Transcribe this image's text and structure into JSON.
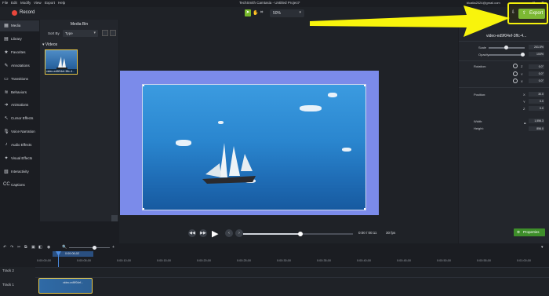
{
  "menu": {
    "items": [
      "File",
      "Edit",
      "Modify",
      "View",
      "Export",
      "Help"
    ],
    "app_title": "TechSmith Camtasia - Untitled Project*",
    "account_email": "blcatla2024@gmail.com",
    "window_controls": [
      "—",
      "□",
      "✕"
    ]
  },
  "toolbar": {
    "record_label": "Record",
    "zoom_value": "50%",
    "export_label": "Export"
  },
  "nav": {
    "items": [
      {
        "label": "Media",
        "icon": "media-icon",
        "active": true
      },
      {
        "label": "Library",
        "icon": "library-icon"
      },
      {
        "label": "Favorites",
        "icon": "star-icon"
      },
      {
        "label": "Annotations",
        "icon": "annotation-icon"
      },
      {
        "label": "Transitions",
        "icon": "transition-icon"
      },
      {
        "label": "Behaviors",
        "icon": "behavior-icon"
      },
      {
        "label": "Animations",
        "icon": "animation-icon"
      },
      {
        "label": "Cursor Effects",
        "icon": "cursor-icon"
      },
      {
        "label": "Voice Narration",
        "icon": "microphone-icon"
      },
      {
        "label": "Audio Effects",
        "icon": "audio-icon"
      },
      {
        "label": "Visual Effects",
        "icon": "visual-effects-icon"
      },
      {
        "label": "Interactivity",
        "icon": "interactivity-icon"
      },
      {
        "label": "Captions",
        "icon": "captions-icon"
      }
    ]
  },
  "media_bin": {
    "title": "Media Bin",
    "sort_label": "Sort By",
    "sort_value": "Type",
    "group": "Videos",
    "clip_name": "video-ed9f04ef-3ffc-4..."
  },
  "playback": {
    "timecode": "0:00 / 00:11",
    "fps": "30 fps",
    "progress": 0.52
  },
  "properties": {
    "clip_title": "video-ed9f04ef-3ffc-4...",
    "scale_label": "Scale",
    "scale_value": "241.5%",
    "opacity_label": "Opacity",
    "opacity_value": "100%",
    "rotation_label": "Rotation:",
    "rotation": {
      "z": "0.0°",
      "y": "0.0°",
      "x": "0.0°"
    },
    "position_label": "Position:",
    "position": {
      "x": "30.0",
      "y": "0.0",
      "z": "0.0"
    },
    "width_label": "Width:",
    "width_value": "1,556.3",
    "height_label": "Height:",
    "height_value": "856.0",
    "button_label": "Properties"
  },
  "timeline": {
    "playhead_time": "0:00:06;02",
    "ticks": [
      "0:00:00;00",
      "0:00:05;00",
      "0:00:10;00",
      "0:00:15;00",
      "0:00:20;00",
      "0:00:25;00",
      "0:00:30;00",
      "0:00:35;00",
      "0:00:40;00",
      "0:00:45;00",
      "0:00:50;00",
      "0:00:55;00",
      "0:01:00;00",
      "0:01:05;00"
    ],
    "tracks": [
      "Track 2",
      "Track 1"
    ],
    "track1_clip_label": "video-ed9f04ef..."
  },
  "colors": {
    "accent_green": "#7cb833",
    "highlight_yellow": "#f5f20c",
    "record_red": "#e8463b",
    "canvas_bg": "#7b8bea"
  }
}
